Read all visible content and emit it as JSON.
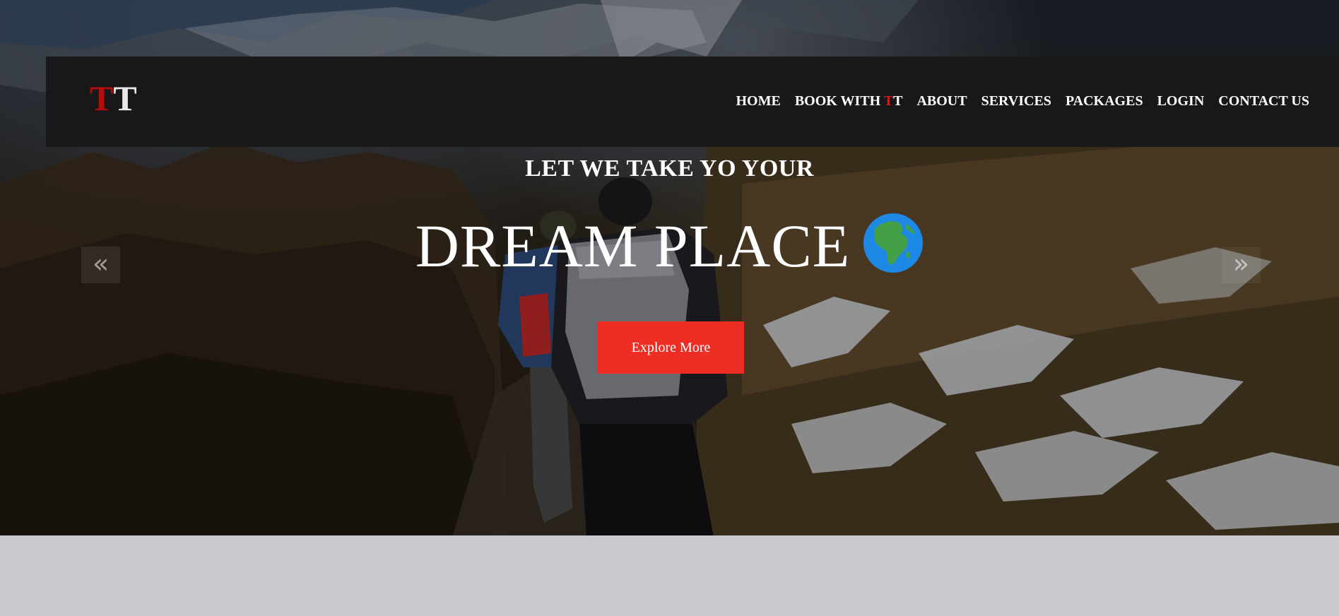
{
  "brand": {
    "logo_first": "T",
    "logo_second": "T"
  },
  "nav": {
    "items": [
      {
        "label": "HOME"
      },
      {
        "label_prefix": "BOOK WITH ",
        "label_highlight": "T",
        "label_suffix": "T"
      },
      {
        "label": "ABOUT"
      },
      {
        "label": "SERVICES"
      },
      {
        "label": "PACKAGES"
      },
      {
        "label": "LOGIN"
      },
      {
        "label": "CONTACT US"
      }
    ]
  },
  "hero": {
    "subtitle": "LET WE TAKE YO YOUR",
    "headline": "DREAM PLACE",
    "headline_emoji": "globe-africa-icon",
    "cta_label": "Explore More",
    "prev_glyph": "«",
    "next_glyph": "»"
  },
  "colors": {
    "nav_bg": "#19171a",
    "accent_red": "#ee2e25",
    "logo_red": "#b40d10",
    "page_bg": "#c9cace"
  }
}
